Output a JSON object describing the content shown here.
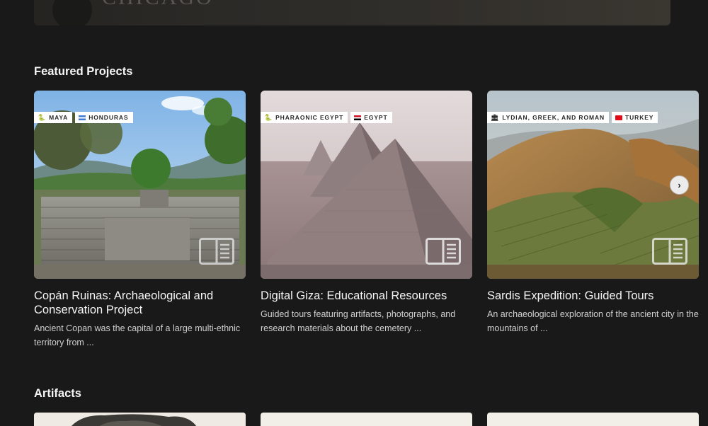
{
  "banner": {
    "wordmark": "CHICAGO"
  },
  "featured": {
    "title": "Featured Projects",
    "next_label": "›",
    "cards": [
      {
        "tags": [
          {
            "icon": "snake-icon",
            "glyph": "🐍",
            "label": "MAYA"
          },
          {
            "icon": "honduras-flag-icon",
            "label": "HONDURAS"
          }
        ],
        "title": "Copán Ruinas: Archaeological and Conservation Project",
        "description": "Ancient Copan was the capital of a large multi-ethnic territory from ..."
      },
      {
        "tags": [
          {
            "icon": "snake-icon",
            "glyph": "🐍",
            "label": "PHARAONIC EGYPT"
          },
          {
            "icon": "egypt-flag-icon",
            "label": "EGYPT"
          }
        ],
        "title": "Digital Giza: Educational Resources",
        "description": "Guided tours featuring artifacts, photographs, and research materials about the cemetery ..."
      },
      {
        "tags": [
          {
            "icon": "temple-icon",
            "glyph": "🏛",
            "label": "LYDIAN, GREEK, AND ROMAN"
          },
          {
            "icon": "turkey-flag-icon",
            "label": "TURKEY"
          }
        ],
        "title": "Sardis Expedition: Guided Tours",
        "description": "An archaeological exploration of the ancient city in the mountains of ..."
      }
    ]
  },
  "artifacts": {
    "title": "Artifacts"
  },
  "colors": {
    "background": "#191919",
    "text": "#f5f5f5",
    "muted": "#d0d0d0",
    "tag_bg": "#ffffff"
  }
}
